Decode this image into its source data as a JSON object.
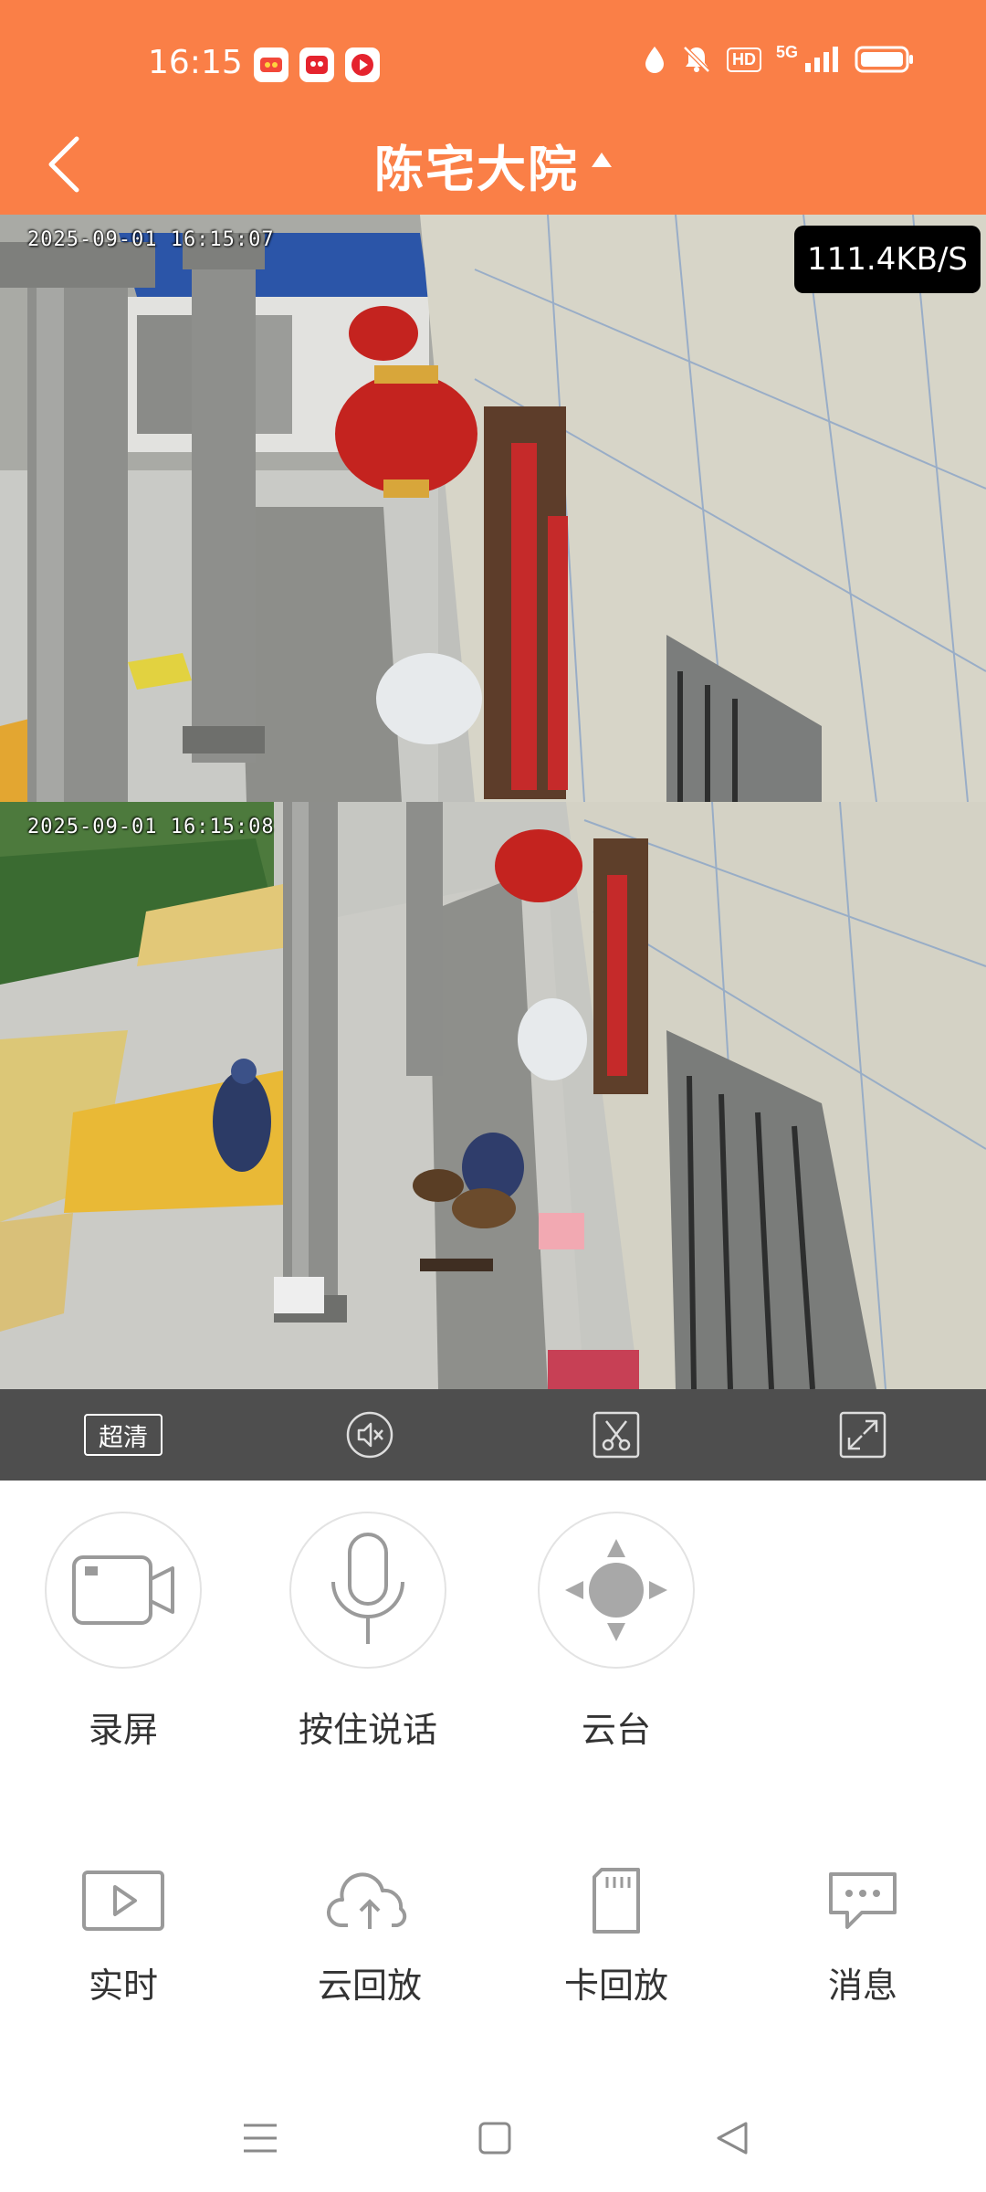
{
  "status_bar": {
    "time": "16:15",
    "network": "5G",
    "hd_badge": "HD"
  },
  "header": {
    "title": "陈宅大院"
  },
  "feeds": [
    {
      "timestamp": "2025-09-01  16:15:07",
      "speed": "111.4KB/S"
    },
    {
      "timestamp": "2025-09-01  16:15:08"
    }
  ],
  "control_bar": {
    "quality_label": "超清"
  },
  "primary_actions": [
    {
      "label": "录屏",
      "icon": "video-camera-icon"
    },
    {
      "label": "按住说话",
      "icon": "microphone-icon"
    },
    {
      "label": "云台",
      "icon": "ptz-direction-icon"
    }
  ],
  "secondary_actions": [
    {
      "label": "实时",
      "icon": "live-play-icon"
    },
    {
      "label": "云回放",
      "icon": "cloud-upload-icon"
    },
    {
      "label": "卡回放",
      "icon": "sd-card-icon"
    },
    {
      "label": "消息",
      "icon": "message-icon"
    }
  ],
  "colors": {
    "header_bg": "#FA7F47",
    "control_bar_bg": "#4E4E4E"
  }
}
